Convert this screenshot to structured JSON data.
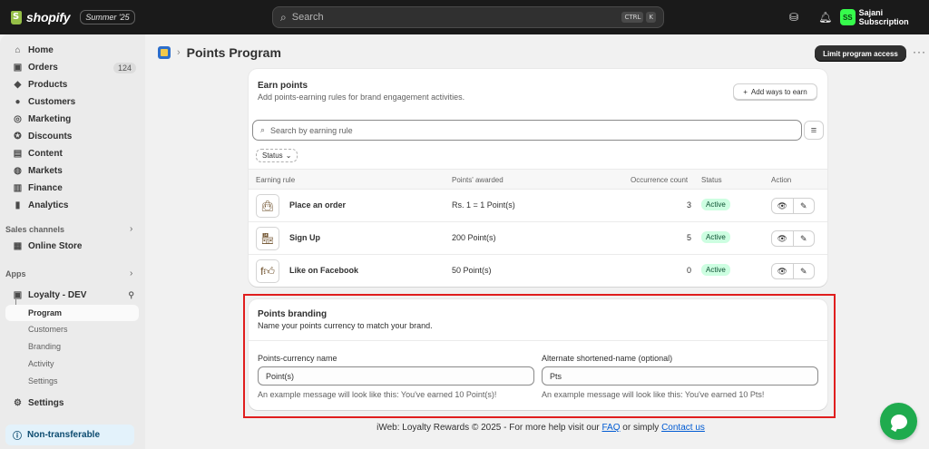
{
  "topbar": {
    "brand": "shopify",
    "edition": "Summer '25",
    "search_placeholder": "Search",
    "kbd1": "CTRL",
    "kbd2": "K",
    "user_initials": "SS",
    "user_name": "Sajani Subscription"
  },
  "sidebar": {
    "items": [
      {
        "label": "Home",
        "icon": "home-icon"
      },
      {
        "label": "Orders",
        "icon": "orders-icon",
        "badge": "124"
      },
      {
        "label": "Products",
        "icon": "products-icon"
      },
      {
        "label": "Customers",
        "icon": "customers-icon"
      },
      {
        "label": "Marketing",
        "icon": "marketing-icon"
      },
      {
        "label": "Discounts",
        "icon": "discounts-icon"
      },
      {
        "label": "Content",
        "icon": "content-icon"
      },
      {
        "label": "Markets",
        "icon": "markets-icon"
      },
      {
        "label": "Finance",
        "icon": "finance-icon"
      },
      {
        "label": "Analytics",
        "icon": "analytics-icon"
      }
    ],
    "sales_channels_label": "Sales channels",
    "online_store": "Online Store",
    "apps_label": "Apps",
    "app_name": "Loyalty - DEV",
    "app_subitems": [
      "Program",
      "Customers",
      "Branding",
      "Activity",
      "Settings"
    ],
    "settings": "Settings",
    "non_transferable": "Non-transferable"
  },
  "header": {
    "title": "Points Program",
    "limit_button": "Limit program access"
  },
  "earn": {
    "title": "Earn points",
    "subtitle": "Add points-earning rules for brand engagement activities.",
    "add_button": "Add ways to earn",
    "search_placeholder": "Search by earning rule",
    "status_filter": "Status",
    "columns": [
      "Earning rule",
      "Points' awarded",
      "Occurrence count",
      "Status",
      "Action"
    ],
    "rows": [
      {
        "name": "Place an order",
        "awarded": "Rs. 1 = 1 Point(s)",
        "count": "3",
        "status": "Active",
        "icon": "shopping-bag-icon"
      },
      {
        "name": "Sign Up",
        "awarded": "200 Point(s)",
        "count": "5",
        "status": "Active",
        "icon": "storefront-icon"
      },
      {
        "name": "Like on Facebook",
        "awarded": "50 Point(s)",
        "count": "0",
        "status": "Active",
        "icon": "facebook-like-icon"
      }
    ]
  },
  "branding": {
    "title": "Points branding",
    "subtitle": "Name your points currency to match your brand.",
    "currency_label": "Points-currency name",
    "currency_value": "Point(s)",
    "currency_help": "An example message will look like this: You've earned 10 Point(s)!",
    "short_label": "Alternate shortened-name (optional)",
    "short_value": "Pts",
    "short_help": "An example message will look like this: You've earned 10 Pts!"
  },
  "footer": {
    "prefix": "iWeb: Loyalty Rewards © 2025 - For more help visit our ",
    "faq": "FAQ",
    "middle": " or simply ",
    "contact": "Contact us"
  },
  "colors": {
    "highlight": "#e01e1e",
    "active_badge_bg": "#cdfee1",
    "chat": "#1fab4e",
    "avatar": "#36fb4c"
  }
}
